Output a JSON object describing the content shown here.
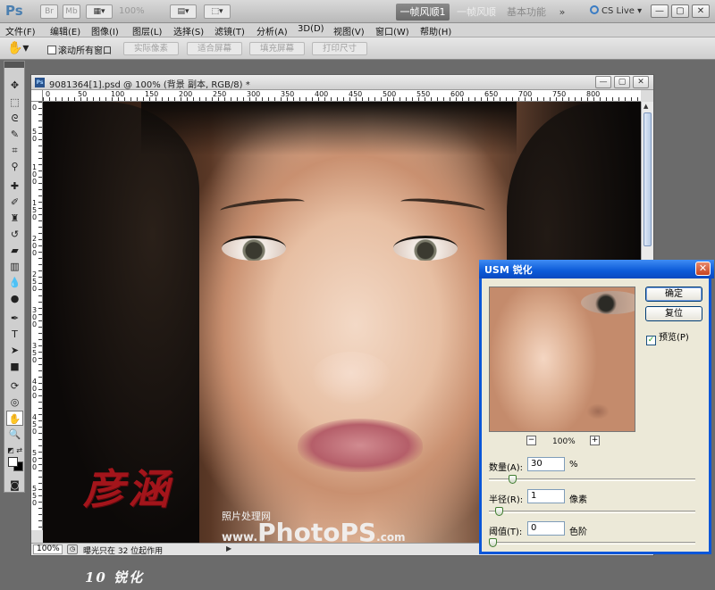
{
  "app": {
    "logo": "Ps",
    "zoom": "100%",
    "workspaces": [
      "一帧风顺1",
      "一帧风顺",
      "基本功能"
    ],
    "more": "»",
    "cs_live": "CS Live",
    "window_buttons": [
      "—",
      "▢",
      "✕"
    ]
  },
  "menu": [
    "文件(F)",
    "编辑(E)",
    "图像(I)",
    "图层(L)",
    "选择(S)",
    "滤镜(T)",
    "分析(A)",
    "3D(D)",
    "视图(V)",
    "窗口(W)",
    "帮助(H)"
  ],
  "options": {
    "scroll_all": "滚动所有窗口",
    "buttons": [
      "实际像素",
      "适合屏幕",
      "填充屏幕",
      "打印尺寸"
    ]
  },
  "document": {
    "title": "9081364[1].psd @ 100% (背景 副本, RGB/8) *",
    "ruler_top": [
      "0",
      "50",
      "100",
      "150",
      "200",
      "250",
      "300",
      "350",
      "400",
      "450",
      "500",
      "550",
      "600",
      "650",
      "700",
      "750",
      "800"
    ],
    "ruler_left": [
      "0",
      "50",
      "100",
      "150",
      "200",
      "250",
      "300",
      "350",
      "400",
      "450",
      "500",
      "550"
    ],
    "zoom": "100%",
    "status": "曝光只在 32 位起作用",
    "signature": "彦涵",
    "watermark_small": "照片处理网",
    "watermark_prefix": "www.",
    "watermark_brand": "PhotoPS",
    "watermark_suffix": ".com"
  },
  "caption": "10 锐化",
  "dialog": {
    "title": "USM 锐化",
    "ok": "确定",
    "reset": "复位",
    "preview_label": "预览(P)",
    "preview_checked": true,
    "zoom_level": "100%",
    "zoom_out": "−",
    "zoom_in": "+",
    "params": [
      {
        "label": "数量(A):",
        "value": "30",
        "unit": "%",
        "slider_fraction": 0.1
      },
      {
        "label": "半径(R):",
        "value": "1",
        "unit": "像素",
        "slider_fraction": 0.03
      },
      {
        "label": "阈值(T):",
        "value": "0",
        "unit": "色阶",
        "slider_fraction": 0.0
      }
    ]
  }
}
